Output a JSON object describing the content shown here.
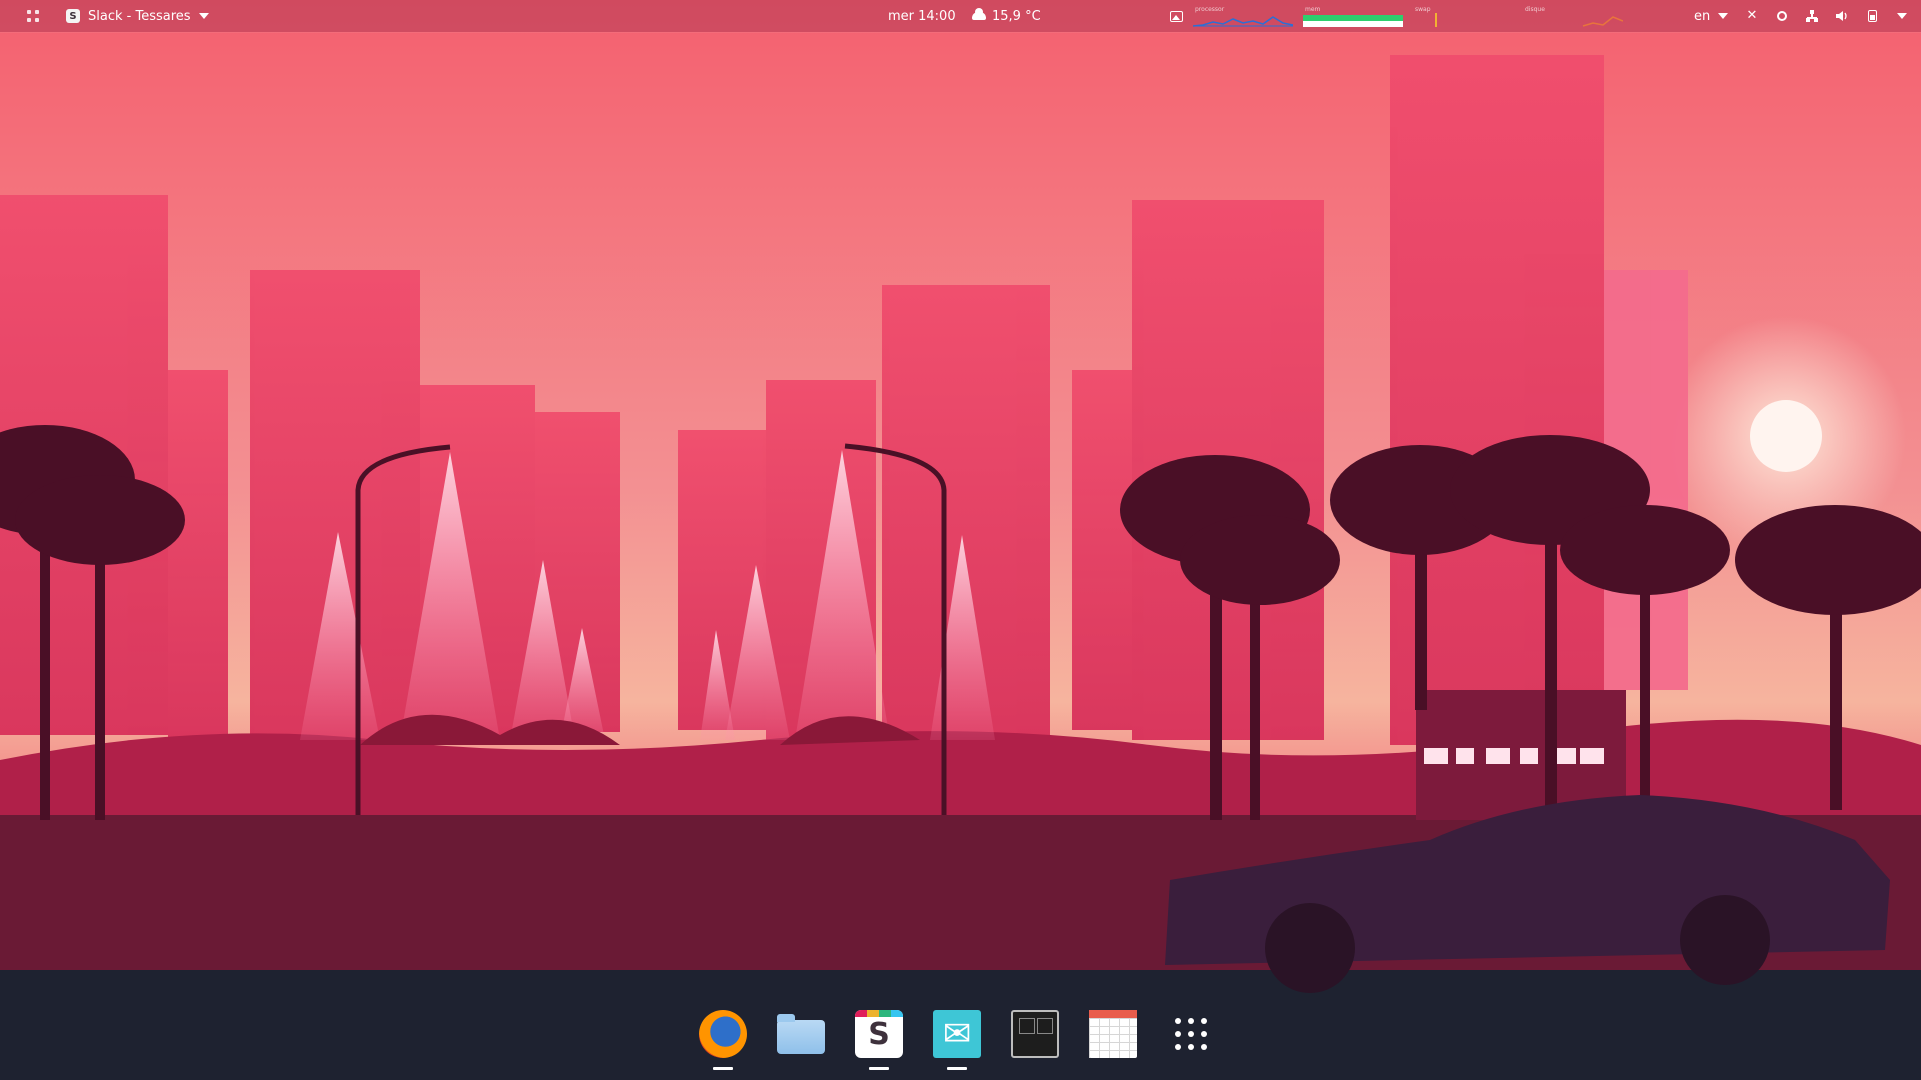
{
  "top_panel": {
    "activities_icon": "grid-icon",
    "app_menu": {
      "icon": "slack-icon",
      "label": "Slack - Tessares"
    },
    "clock": "mer 14:00",
    "weather": {
      "icon": "cloud-icon",
      "temperature": "15,9 °C"
    },
    "system_monitor": {
      "graphs": [
        {
          "label": "processor",
          "color": "#2a6fd6"
        },
        {
          "label": "mem",
          "color": "#2ecf6e",
          "level": 0.55
        },
        {
          "label": "swap",
          "color": "#f2b233"
        },
        {
          "label": "disque",
          "color": "#e8743c"
        }
      ]
    },
    "language": "en",
    "tray_icons": [
      "close-icon",
      "record-icon",
      "network-icon",
      "volume-icon",
      "battery-icon",
      "dropdown-icon"
    ]
  },
  "wallpaper": {
    "description_colors": {
      "sky_top": "#f06a78",
      "sky_mid": "#f5a6a3",
      "sun": "#fff2ee",
      "ground": "#5a1530"
    }
  },
  "dock": {
    "items": [
      {
        "name": "firefox",
        "running": true
      },
      {
        "name": "files",
        "running": false
      },
      {
        "name": "slack",
        "running": true,
        "letter": "S"
      },
      {
        "name": "mail",
        "running": true,
        "glyph": "✉"
      },
      {
        "name": "terminal",
        "running": false
      },
      {
        "name": "spreadsheet",
        "running": false
      },
      {
        "name": "show-applications",
        "running": false
      }
    ]
  }
}
